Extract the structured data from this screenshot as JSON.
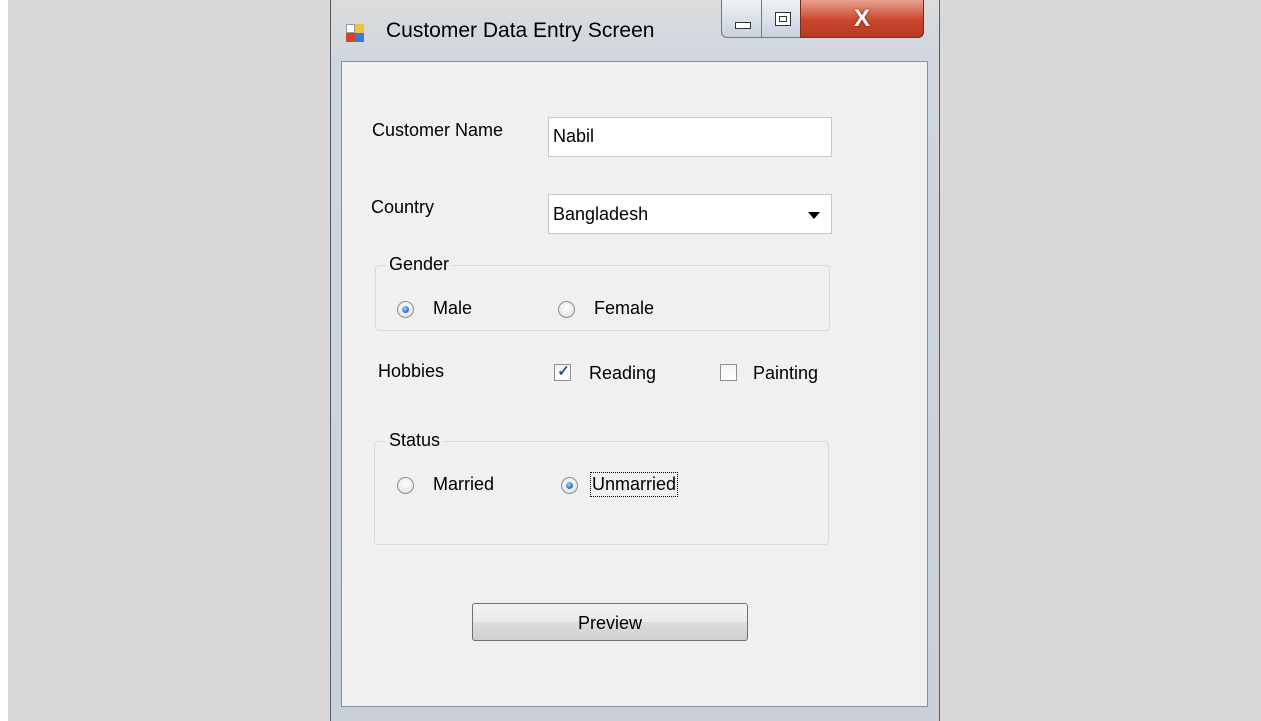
{
  "window": {
    "title": "Customer Data Entry Screen",
    "controls": {
      "minimize": "minimize",
      "maximize": "maximize",
      "close_glyph": "X"
    }
  },
  "form": {
    "customer_name_label": "Customer Name",
    "customer_name_value": "Nabil",
    "country_label": "Country",
    "country_value": "Bangladesh",
    "gender": {
      "legend": "Gender",
      "options": [
        {
          "label": "Male",
          "checked": true
        },
        {
          "label": "Female",
          "checked": false
        }
      ]
    },
    "hobbies": {
      "label": "Hobbies",
      "options": [
        {
          "label": "Reading",
          "checked": true
        },
        {
          "label": "Painting",
          "checked": false
        }
      ],
      "check_glyph": "✓"
    },
    "status": {
      "legend": "Status",
      "options": [
        {
          "label": "Married",
          "checked": false
        },
        {
          "label": "Unmarried",
          "checked": true
        }
      ]
    },
    "preview_button": "Preview"
  },
  "colors": {
    "side_background": "#d8d8d8",
    "client_background": "#f0f0f0",
    "close_button": "#c9462c",
    "radio_dot": "#1f66b3",
    "check_color": "#2d4fa0"
  },
  "icons": {
    "app": "app-window-icon",
    "dropdown": "chevron-down-icon"
  }
}
